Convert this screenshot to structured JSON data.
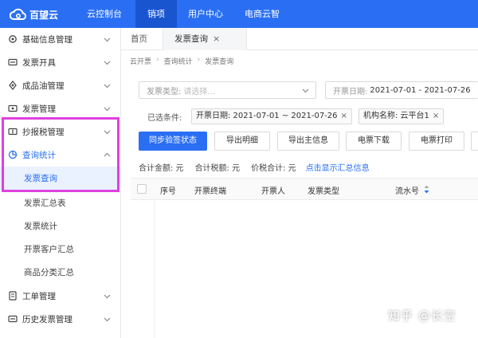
{
  "app": {
    "logo_text": "百望云"
  },
  "topnav": [
    "云控制台",
    "销项",
    "用户中心",
    "电商云智"
  ],
  "sidebar": {
    "items": [
      {
        "label": "基础信息管理",
        "icon": "gear-icon"
      },
      {
        "label": "发票开具",
        "icon": "invoice-icon"
      },
      {
        "label": "成品油管理",
        "icon": "fuel-icon"
      },
      {
        "label": "发票管理",
        "icon": "invoice-manage-icon"
      },
      {
        "label": "抄报税管理",
        "icon": "tax-report-icon"
      },
      {
        "label": "查询统计",
        "icon": "chart-icon"
      }
    ],
    "sub_items": [
      "发票查询",
      "发票汇总表",
      "发票统计",
      "开票客户汇总",
      "商品分类汇总"
    ],
    "bottom_items": [
      {
        "label": "工单管理",
        "icon": "ticket-icon"
      },
      {
        "label": "历史发票管理",
        "icon": "history-icon"
      }
    ]
  },
  "tabs": {
    "home": "首页",
    "current": "发票查询",
    "close": "×"
  },
  "breadcrumb": [
    "云开票",
    "查询统计",
    "发票查询"
  ],
  "filters": {
    "type_label": "发票类型:",
    "type_placeholder": "请选择...",
    "date_label": "开票日期:",
    "date_value": "2021-07-01 - 2021-07-26"
  },
  "selected": {
    "label": "已选条件:",
    "tags": [
      "开票日期: 2021-07-01 ~ 2021-07-26",
      "机构名称: 云平台1"
    ]
  },
  "buttons": [
    "同步验签状态",
    "导出明细",
    "导出主信息",
    "电票下载",
    "电票打印"
  ],
  "totals": {
    "amount": "合计金额: 元",
    "tax": "合计税额: 元",
    "sum": "价税合计: 元",
    "link": "点击显示汇总信息"
  },
  "table": {
    "columns": [
      "序号",
      "开票终端",
      "开票人",
      "发票类型",
      "流水号"
    ]
  },
  "watermark": "知乎 @长空",
  "colors": {
    "primary": "#2a6ff3",
    "highlight": "#e040e0"
  }
}
